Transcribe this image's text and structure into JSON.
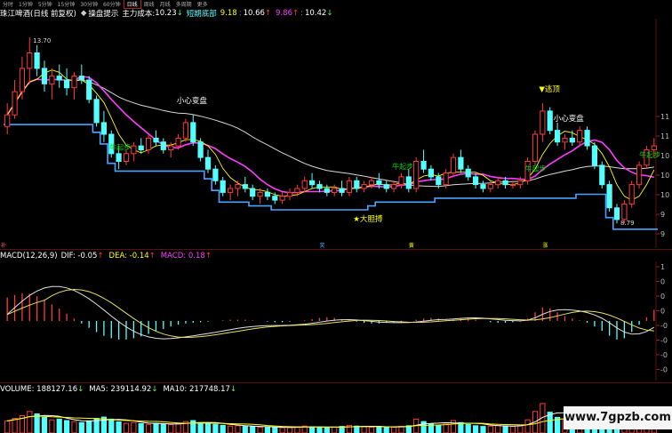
{
  "periods": {
    "items": [
      "分时",
      "1分钟",
      "5分钟",
      "15分钟",
      "30分钟",
      "60分钟",
      "日线",
      "周线",
      "月线",
      "多周期",
      "更多"
    ],
    "selected": "日线"
  },
  "header": {
    "title": "珠江啤酒(日线 前复权)",
    "indicator_name": "操盘提示",
    "cost_label": "主力成本:",
    "cost_value": "10.23",
    "cost_arrow": "↓",
    "bottom_label": "短期底部",
    "v1": "9.18",
    "v2": "10.66",
    "v2_arrow": "↑",
    "v3": "9.86",
    "v3_arrow": "↑",
    "v4": "10.42",
    "v4_arrow": "↓"
  },
  "macd_header": {
    "label": "MACD(12,26,9)",
    "dif": "DIF: -0.05",
    "dif_arrow": "↑",
    "dea": "DEA: -0.14",
    "dea_arrow": "↑",
    "macd": "MACD: 0.18",
    "macd_arrow": "↑"
  },
  "vol_header": {
    "label": "VOLUME: 188127.16",
    "vol_arrow": "↓",
    "ma5": "MA5: 239114.92",
    "ma5_arrow": "↓",
    "ma10": "MA10: 217748.17",
    "ma10_arrow": "↓"
  },
  "watermark": "www.7gpzb.com",
  "colors": {
    "up": "#ff3a3a",
    "down": "#54ffff",
    "ma_fast": "#ffff00",
    "ma_mid": "#ff3cff",
    "ma_slow": "#d8d8d8",
    "support": "#4aa3ff",
    "dif_line": "#e0e0e0",
    "dea_line": "#e8e060",
    "annot_yellow": "#ffff00",
    "annot_green": "#00d000",
    "annot_white": "#ffffff"
  },
  "chart_data": [
    {
      "type": "candlestick",
      "title": "珠江啤酒(日线 前复权)",
      "y_ticks": [
        "11",
        "11",
        "10",
        "10",
        "10",
        "9",
        "9"
      ],
      "ylim": [
        8.4,
        14.0
      ],
      "candles": [
        [
          11.4,
          12.0,
          11.2,
          11.7
        ],
        [
          11.7,
          12.6,
          11.6,
          12.3
        ],
        [
          12.3,
          13.2,
          12.1,
          12.9
        ],
        [
          12.9,
          13.7,
          12.5,
          13.3
        ],
        [
          13.3,
          13.5,
          12.7,
          12.9
        ],
        [
          12.9,
          13.1,
          12.3,
          12.5
        ],
        [
          12.5,
          12.9,
          12.1,
          12.7
        ],
        [
          12.7,
          13.0,
          12.4,
          12.6
        ],
        [
          12.6,
          12.9,
          12.2,
          12.4
        ],
        [
          12.4,
          12.8,
          12.1,
          12.7
        ],
        [
          12.7,
          13.0,
          12.5,
          12.6
        ],
        [
          12.6,
          12.7,
          12.0,
          12.1
        ],
        [
          12.1,
          12.2,
          11.4,
          11.5
        ],
        [
          11.5,
          11.8,
          11.0,
          11.2
        ],
        [
          11.2,
          11.3,
          10.6,
          10.7
        ],
        [
          10.7,
          10.9,
          10.3,
          10.5
        ],
        [
          10.5,
          10.8,
          10.4,
          10.7
        ],
        [
          10.7,
          11.0,
          10.5,
          10.9
        ],
        [
          10.9,
          11.1,
          10.7,
          10.8
        ],
        [
          10.8,
          11.2,
          10.7,
          11.1
        ],
        [
          11.1,
          11.3,
          10.9,
          11.0
        ],
        [
          11.0,
          11.1,
          10.7,
          10.8
        ],
        [
          10.8,
          11.0,
          10.6,
          10.9
        ],
        [
          10.9,
          11.2,
          10.8,
          11.1
        ],
        [
          11.1,
          11.6,
          11.0,
          11.5
        ],
        [
          11.5,
          11.7,
          10.9,
          11.0
        ],
        [
          11.0,
          11.1,
          10.5,
          10.6
        ],
        [
          10.6,
          10.8,
          10.2,
          10.3
        ],
        [
          10.3,
          10.4,
          9.9,
          10.0
        ],
        [
          10.0,
          10.1,
          9.6,
          9.7
        ],
        [
          9.7,
          9.9,
          9.5,
          9.8
        ],
        [
          9.8,
          10.0,
          9.6,
          9.9
        ],
        [
          9.9,
          10.1,
          9.7,
          9.8
        ],
        [
          9.8,
          9.9,
          9.5,
          9.6
        ],
        [
          9.6,
          9.8,
          9.4,
          9.7
        ],
        [
          9.7,
          9.8,
          9.5,
          9.6
        ],
        [
          9.6,
          9.7,
          9.4,
          9.5
        ],
        [
          9.5,
          9.7,
          9.4,
          9.6
        ],
        [
          9.6,
          9.8,
          9.5,
          9.7
        ],
        [
          9.7,
          9.9,
          9.6,
          9.8
        ],
        [
          9.8,
          10.1,
          9.7,
          10.0
        ],
        [
          10.0,
          10.2,
          9.8,
          9.9
        ],
        [
          9.9,
          10.0,
          9.7,
          9.8
        ],
        [
          9.8,
          9.9,
          9.6,
          9.7
        ],
        [
          9.7,
          9.9,
          9.6,
          9.8
        ],
        [
          9.8,
          10.0,
          9.6,
          9.7
        ],
        [
          9.7,
          10.1,
          9.6,
          10.0
        ],
        [
          10.0,
          10.1,
          9.7,
          9.8
        ],
        [
          9.8,
          10.0,
          9.7,
          9.9
        ],
        [
          9.9,
          10.1,
          9.8,
          10.0
        ],
        [
          10.0,
          10.2,
          9.8,
          9.9
        ],
        [
          9.9,
          10.0,
          9.7,
          9.8
        ],
        [
          9.8,
          10.0,
          9.7,
          9.9
        ],
        [
          9.9,
          10.2,
          9.8,
          10.1
        ],
        [
          10.1,
          10.3,
          9.7,
          9.8
        ],
        [
          9.8,
          10.6,
          9.7,
          10.5
        ],
        [
          10.5,
          10.8,
          10.2,
          10.3
        ],
        [
          10.3,
          10.4,
          10.0,
          10.1
        ],
        [
          10.1,
          10.2,
          9.8,
          9.9
        ],
        [
          9.9,
          10.3,
          9.8,
          10.2
        ],
        [
          10.2,
          10.7,
          10.1,
          10.6
        ],
        [
          10.6,
          10.8,
          10.2,
          10.3
        ],
        [
          10.3,
          10.4,
          10.0,
          10.1
        ],
        [
          10.1,
          10.2,
          9.8,
          9.9
        ],
        [
          9.9,
          10.0,
          9.7,
          9.8
        ],
        [
          9.8,
          10.0,
          9.7,
          9.9
        ],
        [
          9.9,
          10.1,
          9.8,
          10.0
        ],
        [
          10.0,
          10.1,
          9.8,
          9.9
        ],
        [
          9.9,
          10.0,
          9.8,
          9.9
        ],
        [
          9.9,
          10.1,
          9.8,
          10.0
        ],
        [
          10.0,
          10.6,
          9.9,
          10.5
        ],
        [
          10.5,
          11.3,
          10.4,
          11.2
        ],
        [
          11.2,
          12.0,
          11.0,
          11.8
        ],
        [
          11.8,
          11.9,
          11.2,
          11.3
        ],
        [
          11.3,
          11.5,
          10.9,
          11.0
        ],
        [
          11.0,
          11.2,
          10.8,
          11.1
        ],
        [
          11.1,
          11.3,
          10.9,
          11.0
        ],
        [
          11.0,
          11.4,
          10.9,
          11.3
        ],
        [
          11.3,
          11.4,
          10.8,
          10.9
        ],
        [
          10.9,
          11.0,
          10.3,
          10.4
        ],
        [
          10.4,
          10.5,
          9.8,
          9.9
        ],
        [
          9.9,
          10.0,
          9.2,
          9.3
        ],
        [
          9.3,
          9.4,
          8.9,
          9.0
        ],
        [
          9.0,
          9.5,
          8.9,
          9.4
        ],
        [
          9.4,
          10.0,
          9.3,
          9.9
        ],
        [
          9.9,
          10.5,
          9.8,
          10.4
        ],
        [
          10.4,
          10.9,
          10.3,
          10.8
        ],
        [
          10.8,
          11.1,
          10.6,
          10.9
        ]
      ]
    },
    {
      "type": "bar",
      "title": "MACD(12,26,9)",
      "y_ticks": [
        "1",
        "0",
        "0",
        "0",
        "-0",
        "-0",
        "-0",
        "-0"
      ],
      "ylim": [
        -0.85,
        0.85
      ],
      "dif_start": 0.62,
      "dif_end": -0.05,
      "dea_start": 0.58,
      "dea_end": -0.14,
      "macd_values": [
        0.38,
        0.42,
        0.45,
        0.44,
        0.4,
        0.34,
        0.27,
        0.2,
        0.12,
        0.04,
        -0.04,
        -0.11,
        -0.18,
        -0.24,
        -0.28,
        -0.3,
        -0.3,
        -0.28,
        -0.25,
        -0.21,
        -0.17,
        -0.13,
        -0.09,
        -0.06,
        -0.04,
        -0.03,
        -0.02,
        -0.01,
        0.0,
        0.01,
        0.02,
        0.02,
        0.02,
        0.01,
        0.0,
        -0.01,
        -0.02,
        -0.02,
        -0.01,
        0.0,
        0.01,
        0.03,
        0.05,
        0.06,
        0.05,
        0.03,
        0.01,
        -0.01,
        -0.03,
        -0.04,
        -0.04,
        -0.03,
        -0.02,
        -0.01,
        0.0,
        0.02,
        0.04,
        0.05,
        0.04,
        0.02,
        0.03,
        0.05,
        0.04,
        0.02,
        0.0,
        -0.02,
        -0.03,
        -0.03,
        -0.02,
        -0.01,
        0.04,
        0.14,
        0.22,
        0.2,
        0.14,
        0.08,
        0.04,
        0.01,
        -0.03,
        -0.09,
        -0.16,
        -0.24,
        -0.3,
        -0.28,
        -0.18,
        -0.06,
        0.06,
        0.18
      ]
    },
    {
      "type": "bar",
      "title": "VOLUME",
      "volume_values": [
        0.35,
        0.42,
        0.5,
        0.62,
        0.55,
        0.45,
        0.38,
        0.4,
        0.36,
        0.33,
        0.3,
        0.35,
        0.42,
        0.46,
        0.4,
        0.32,
        0.28,
        0.3,
        0.27,
        0.25,
        0.28,
        0.26,
        0.24,
        0.27,
        0.33,
        0.36,
        0.3,
        0.27,
        0.25,
        0.22,
        0.2,
        0.21,
        0.19,
        0.18,
        0.17,
        0.16,
        0.17,
        0.15,
        0.16,
        0.18,
        0.2,
        0.18,
        0.16,
        0.15,
        0.17,
        0.19,
        0.22,
        0.2,
        0.18,
        0.17,
        0.19,
        0.16,
        0.17,
        0.19,
        0.21,
        0.4,
        0.33,
        0.26,
        0.22,
        0.28,
        0.36,
        0.3,
        0.25,
        0.21,
        0.19,
        0.2,
        0.22,
        0.2,
        0.19,
        0.21,
        0.38,
        0.62,
        0.85,
        0.6,
        0.45,
        0.4,
        0.36,
        0.42,
        0.37,
        0.44,
        0.5,
        0.55,
        0.46,
        0.4,
        0.48,
        0.58,
        0.66,
        0.52
      ]
    }
  ],
  "annotations": {
    "high_value": "13.70",
    "low_value": "8.79",
    "caution1": "小心变盘",
    "caution2": "小心变盘",
    "escape_top": "▼逃顶",
    "bold_buy": "★大胆搏",
    "start_rise1": "牛起步",
    "start_rise2": "牛起步",
    "start_rise3": "牛起步",
    "start_rise4": "牛起步",
    "mark_bu": "补",
    "mark_jiang": "奖",
    "mark_huang": "黄",
    "mark_zhang": "涨"
  }
}
